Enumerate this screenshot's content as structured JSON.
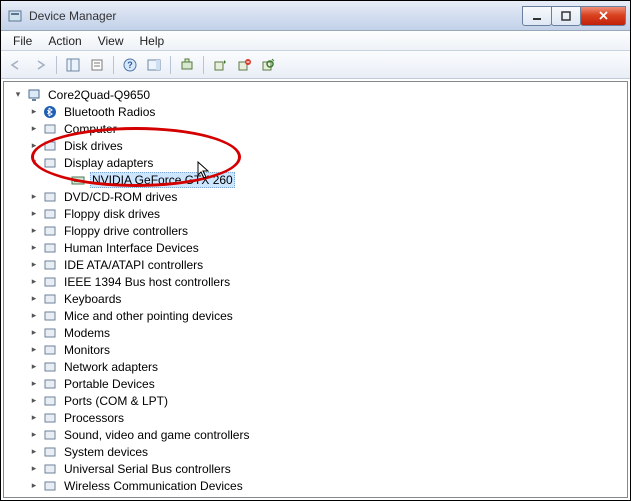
{
  "window": {
    "title": "Device Manager"
  },
  "menu": {
    "file": "File",
    "action": "Action",
    "view": "View",
    "help": "Help"
  },
  "tree": {
    "root": "Core2Quad-Q9650",
    "items": [
      "Bluetooth Radios",
      "Computer",
      "Disk drives",
      "Display adapters",
      "DVD/CD-ROM drives",
      "Floppy disk drives",
      "Floppy drive controllers",
      "Human Interface Devices",
      "IDE ATA/ATAPI controllers",
      "IEEE 1394 Bus host controllers",
      "Keyboards",
      "Mice and other pointing devices",
      "Modems",
      "Monitors",
      "Network adapters",
      "Portable Devices",
      "Ports (COM & LPT)",
      "Processors",
      "Sound, video and game controllers",
      "System devices",
      "Universal Serial Bus controllers",
      "Wireless Communication Devices"
    ],
    "display_child": "NVIDIA GeForce GTX 260"
  },
  "annotation": {
    "color": "#d40000"
  }
}
